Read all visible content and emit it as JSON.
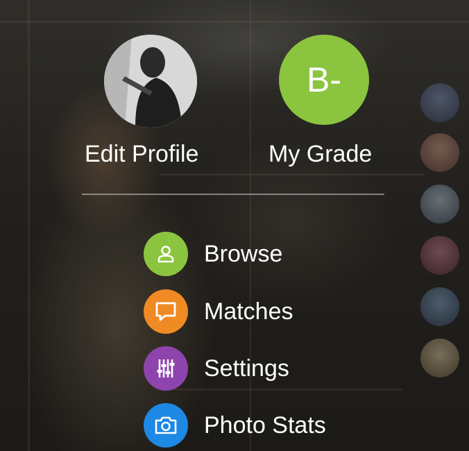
{
  "profile": {
    "edit_label": "Edit Profile",
    "grade_label": "My Grade",
    "grade_value": "B-",
    "grade_color": "#8bc53f"
  },
  "menu": {
    "items": [
      {
        "label": "Browse",
        "icon": "person-icon",
        "color": "#8bc53f"
      },
      {
        "label": "Matches",
        "icon": "chat-icon",
        "color": "#f08a24"
      },
      {
        "label": "Settings",
        "icon": "sliders-icon",
        "color": "#8e44ad"
      },
      {
        "label": "Photo Stats",
        "icon": "camera-icon",
        "color": "#1e88e5"
      }
    ]
  },
  "side_thumbnails": [
    {
      "icon": "user-thumbnail-icon",
      "color": "#4a5d7a"
    },
    {
      "icon": "user-thumbnail-icon",
      "color": "#8a6a5a"
    },
    {
      "icon": "user-thumbnail-icon",
      "color": "#6a7a8a"
    },
    {
      "icon": "user-thumbnail-icon",
      "color": "#8a4a5a"
    },
    {
      "icon": "user-thumbnail-icon",
      "color": "#4a6a8a"
    },
    {
      "icon": "user-thumbnail-icon",
      "color": "#9a8a6a"
    }
  ]
}
